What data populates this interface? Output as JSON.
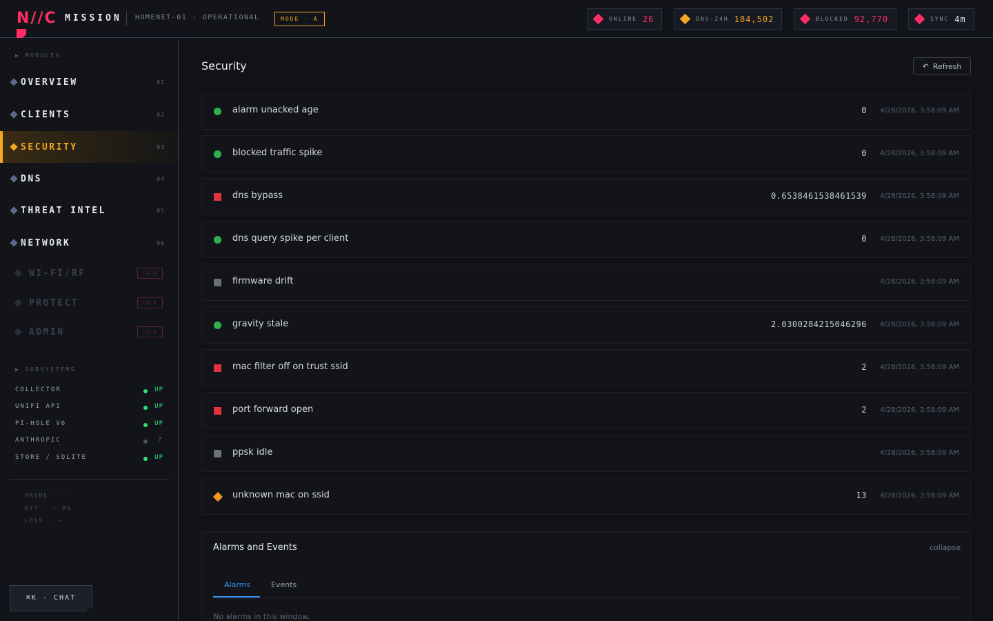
{
  "topbar": {
    "logo": "N//C",
    "brand": "MISSION",
    "host": "HOMENET-01",
    "separator": "·",
    "status": "OPERATIONAL",
    "mode": "MODE · A",
    "stats": [
      {
        "label": "ONLINE",
        "value": "26",
        "color": "#ff2d64"
      },
      {
        "label": "DNS·24H",
        "value": "184,502",
        "color": "#f5a623"
      },
      {
        "label": "BLOCKED",
        "value": "92,770",
        "color": "#ff2d64"
      },
      {
        "label": "SYNC",
        "value": "4m",
        "color": "#e6e9ef"
      }
    ]
  },
  "sidebar": {
    "modules_heading": "▶  MODULES",
    "items": [
      {
        "label": "OVERVIEW",
        "num": "01"
      },
      {
        "label": "CLIENTS",
        "num": "02"
      },
      {
        "label": "SECURITY",
        "num": "03"
      },
      {
        "label": "DNS",
        "num": "04"
      },
      {
        "label": "THREAT INTEL",
        "num": "05"
      },
      {
        "label": "NETWORK",
        "num": "06"
      }
    ],
    "locked_items": [
      {
        "label": "WI-FI/RF",
        "badge": "LOCK"
      },
      {
        "label": "PROTECT",
        "badge": "LOCK"
      },
      {
        "label": "ADMIN",
        "badge": "LOCK"
      }
    ],
    "subsystems_heading": "▶  SUBSYSTEMS",
    "subsystems": [
      {
        "name": "COLLECTOR",
        "status": "UP"
      },
      {
        "name": "UNIFI API",
        "status": "UP"
      },
      {
        "name": "PI-HOLE V6",
        "status": "UP"
      },
      {
        "name": "ANTHROPIC",
        "status": "?"
      },
      {
        "name": "STORE / SQLITE",
        "status": "UP"
      }
    ],
    "probe": [
      "PROBE · —",
      "RTT · — MS",
      "LOSS · —"
    ],
    "chat_button": "⌘K · CHAT"
  },
  "main": {
    "title": "Security",
    "refresh_label": "Refresh",
    "alarms": [
      {
        "name": "alarm unacked age",
        "value": "0",
        "time": "4/28/2026, 3:58:09 AM",
        "state": "ok"
      },
      {
        "name": "blocked traffic spike",
        "value": "0",
        "time": "4/28/2026, 3:58:09 AM",
        "state": "ok"
      },
      {
        "name": "dns bypass",
        "value": "0.6538461538461539",
        "time": "4/28/2026, 3:58:09 AM",
        "state": "bad"
      },
      {
        "name": "dns query spike per client",
        "value": "0",
        "time": "4/28/2026, 3:58:09 AM",
        "state": "ok"
      },
      {
        "name": "firmware drift",
        "value": "",
        "time": "4/28/2026, 3:58:09 AM",
        "state": "idle"
      },
      {
        "name": "gravity stale",
        "value": "2.0300284215046296",
        "time": "4/28/2026, 3:58:09 AM",
        "state": "ok"
      },
      {
        "name": "mac filter off on trust ssid",
        "value": "2",
        "time": "4/28/2026, 3:58:09 AM",
        "state": "bad"
      },
      {
        "name": "port forward open",
        "value": "2",
        "time": "4/28/2026, 3:58:09 AM",
        "state": "bad"
      },
      {
        "name": "ppsk idle",
        "value": "",
        "time": "4/28/2026, 3:58:09 AM",
        "state": "idle"
      },
      {
        "name": "unknown mac on ssid",
        "value": "13",
        "time": "4/28/2026, 3:58:09 AM",
        "state": "warn"
      }
    ],
    "events_panel": {
      "title": "Alarms and Events",
      "collapse_label": "collapse",
      "tabs": [
        "Alarms",
        "Events"
      ],
      "empty_text": "No alarms in this window."
    }
  },
  "colors": {
    "accent": "#f5a623",
    "brand": "#ff2d64",
    "ok": "#2fb04a",
    "bad": "#e0343a",
    "idle": "#6c7078",
    "warn": "#f0971e",
    "link": "#3b8ff0",
    "up": "#2ee07a"
  }
}
